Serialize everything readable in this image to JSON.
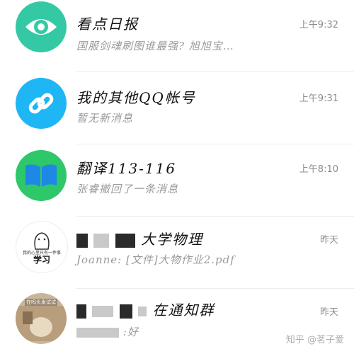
{
  "chats": [
    {
      "title": "看点日报",
      "preview": "国服剑魂刷图谁最强? 旭旭宝…",
      "time": "上午9:32",
      "avatar_icon": "eye-icon",
      "avatar_color": "#34c9a4"
    },
    {
      "title": "我的其他QQ帐号",
      "preview": "暂无新消息",
      "time": "上午9:31",
      "avatar_icon": "link-icon",
      "avatar_color": "#1fb6f5"
    },
    {
      "title": "翻译113-116",
      "preview": "张睿撤回了一条消息",
      "time": "上午8:10",
      "avatar_icon": "book-icon",
      "avatar_color": "#2ec76a"
    },
    {
      "title": "大学物理",
      "preview": "Joanne: [文件]大物作业2.pdf",
      "time": "昨天",
      "avatar_icon": "cartoon-avatar-icon",
      "avatar_caption": "我的心里只有一件事",
      "avatar_big_text": "学习"
    },
    {
      "title": "在通知群",
      "preview": ":好",
      "time": "昨天",
      "avatar_icon": "photo-avatar-icon",
      "avatar_caption": "在吗头发试试"
    }
  ],
  "watermark": "知乎 @茗子爱"
}
